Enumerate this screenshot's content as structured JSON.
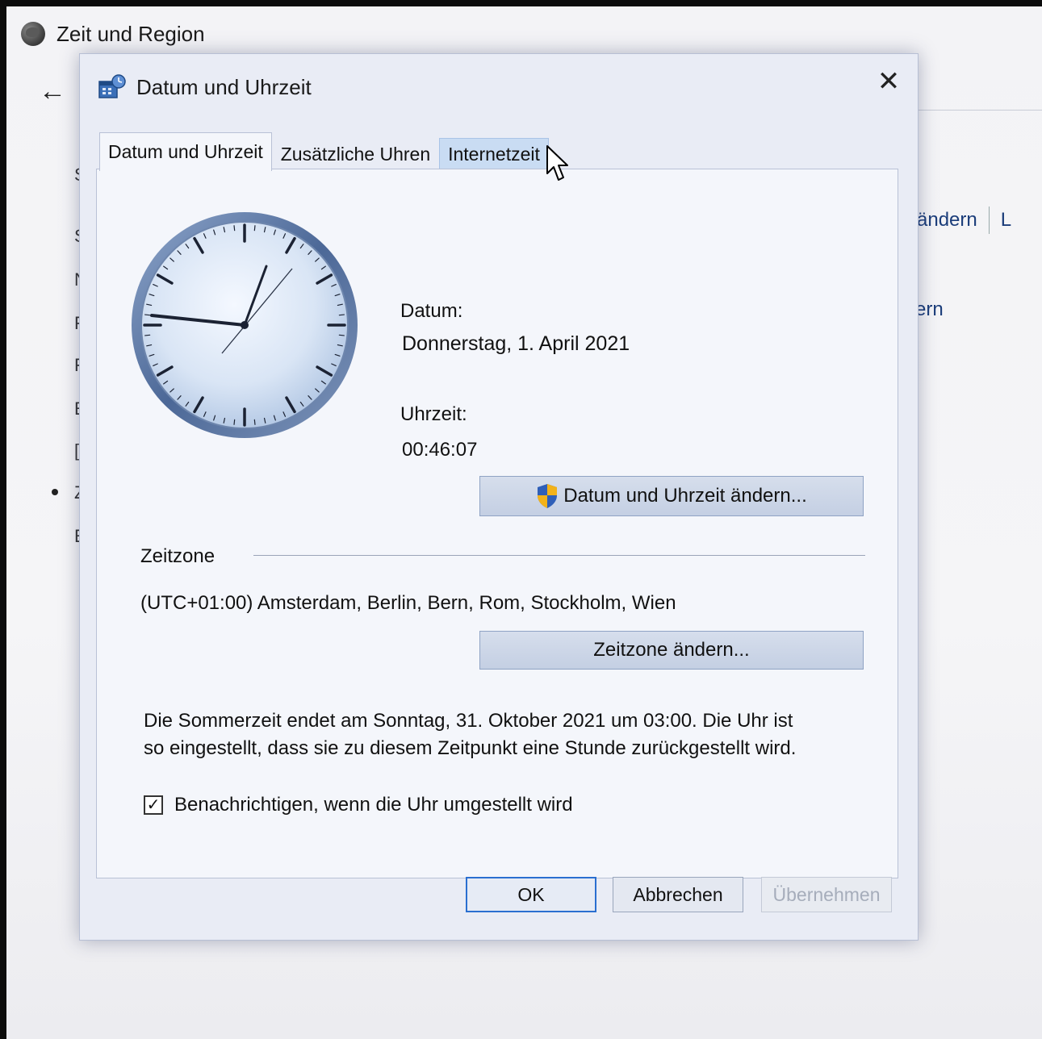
{
  "background_window": {
    "title": "Zeit und Region",
    "back_icon": "arrow-left-icon",
    "right_link_1": "ändern",
    "right_link_2": "L",
    "right_link_3": "ern",
    "left_letters": [
      "S",
      "S",
      "N",
      "F",
      "F",
      "E",
      "[",
      "Z",
      "E"
    ]
  },
  "dialog": {
    "title": "Datum und Uhrzeit",
    "close_icon": "close-icon",
    "tabs": [
      {
        "label": "Datum und Uhrzeit",
        "active": true
      },
      {
        "label": "Zusätzliche Uhren",
        "active": false
      },
      {
        "label": "Internetzeit",
        "active": false,
        "hovered": true
      }
    ],
    "clock_icon": "analog-clock-icon",
    "date_label": "Datum:",
    "date_value": "Donnerstag, 1. April 2021",
    "time_label": "Uhrzeit:",
    "time_value": "00:46:07",
    "change_datetime_button": "Datum und Uhrzeit ändern...",
    "change_datetime_icon": "uac-shield-icon",
    "timezone_heading": "Zeitzone",
    "timezone_value": "(UTC+01:00) Amsterdam, Berlin, Bern, Rom, Stockholm, Wien",
    "change_timezone_button": "Zeitzone ändern...",
    "dst_line_1": "Die Sommerzeit endet am Sonntag, 31. Oktober 2021 um 03:00. Die Uhr ist",
    "dst_line_2": "so eingestellt, dass sie zu diesem Zeitpunkt eine Stunde zurückgestellt wird.",
    "notify_checkbox_label": "Benachrichtigen, wenn die Uhr umgestellt wird",
    "notify_checked": true,
    "ok_button": "OK",
    "cancel_button": "Abbrechen",
    "apply_button": "Übernehmen",
    "apply_enabled": false
  },
  "colors": {
    "accent": "#2a6fd0",
    "link": "#1b3d7a",
    "tab_hover": "#c9dcf3"
  }
}
